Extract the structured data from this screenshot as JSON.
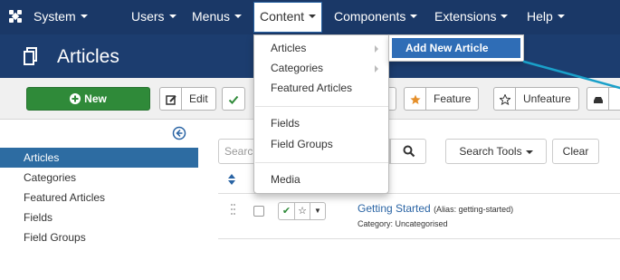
{
  "navbar": {
    "logo_icon": "joomla-logo-icon",
    "items": [
      {
        "label": "System"
      },
      {
        "label": "Users"
      },
      {
        "label": "Menus"
      },
      {
        "label": "Content"
      },
      {
        "label": "Components"
      },
      {
        "label": "Extensions"
      },
      {
        "label": "Help"
      }
    ],
    "active": "Content",
    "background": "#1a3867"
  },
  "header": {
    "title": "Articles",
    "icon": "stack-icon",
    "background": "#1c3d6f"
  },
  "toolbar": {
    "new_label": "New",
    "edit_label": "Edit",
    "feature_label": "Feature",
    "unfeature_label": "Unfeature",
    "new_color": "#2f8a39"
  },
  "sidebar": {
    "items": [
      {
        "label": "Articles"
      },
      {
        "label": "Categories"
      },
      {
        "label": "Featured Articles"
      },
      {
        "label": "Fields"
      },
      {
        "label": "Field Groups"
      }
    ],
    "active": "Articles",
    "active_color": "#2d6ca2"
  },
  "filters": {
    "search_placeholder": "Search",
    "search_tools_label": "Search Tools",
    "clear_label": "Clear"
  },
  "articles": [
    {
      "title": "Getting Started",
      "alias": "(Alias: getting-started)",
      "category": "Category: Uncategorised",
      "status": "published"
    }
  ],
  "content_menu": {
    "items": [
      {
        "label": "Articles"
      },
      {
        "label": "Categories"
      },
      {
        "label": "Featured Articles"
      },
      {
        "label": "Fields"
      },
      {
        "label": "Field Groups"
      },
      {
        "label": "Media"
      }
    ],
    "submenu": {
      "label": "Add New Article",
      "highlight_color": "#2f6db6"
    }
  }
}
